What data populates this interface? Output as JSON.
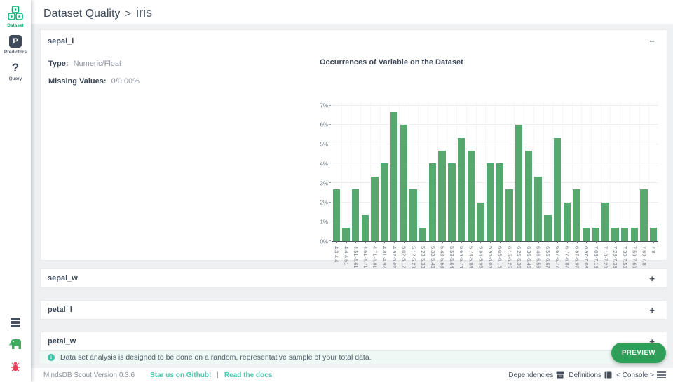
{
  "header": {
    "breadcrumb": "Dataset Quality",
    "separator": ">",
    "dataset": "iris"
  },
  "sidebar": {
    "items": [
      {
        "label": "Dataset"
      },
      {
        "label": "Predictors",
        "icon_text": "P"
      },
      {
        "label": "Query",
        "icon_text": "?"
      }
    ]
  },
  "panels": [
    {
      "title": "sepal_l",
      "toggle": "−",
      "fields": [
        {
          "label": "Type:",
          "value": "Numeric/Float"
        },
        {
          "label": "Missing Values:",
          "value": "0/0.00%"
        }
      ]
    },
    {
      "title": "sepal_w",
      "toggle": "+"
    },
    {
      "title": "petal_l",
      "toggle": "+"
    },
    {
      "title": "petal_w",
      "toggle": "+"
    }
  ],
  "info_bar": {
    "icon_glyph": "i",
    "text": "Data set analysis is designed to be done on a random, representative sample of your total data."
  },
  "preview_button": {
    "label": "PREVIEW"
  },
  "footer": {
    "version": "MindsDB Scout Version 0.3.6",
    "star_link": "Star us on Github!",
    "divider": "|",
    "docs_link": "Read the docs",
    "dependencies_label": "Dependencies",
    "definitions_label": "Definitions",
    "console_label": "< Console >"
  },
  "colors": {
    "accent_green": "#00b06d",
    "preview_green": "#2f9e58",
    "link_teal": "#53c4ae",
    "info_teal": "#3fc0a8",
    "bug_red": "#e4445a"
  },
  "chart_data": {
    "type": "bar",
    "title": "Occurrences of Variable on the Dataset",
    "xlabel": "",
    "ylabel": "",
    "categories": [
      "4.3-4.4",
      "4.4-4.51",
      "4.51-4.61",
      "4.61-4.71",
      "4.71-4.81",
      "4.81-4.92",
      "4.92-5.02",
      "5.02-5.12",
      "5.12-5.23",
      "5.23-5.33",
      "5.33-5.43",
      "5.43-5.53",
      "5.53-5.64",
      "5.64-5.74",
      "5.74-5.84",
      "5.84-5.95",
      "5.95-6.05",
      "6.05-6.15",
      "6.15-6.25",
      "6.25-6.36",
      "6.36-6.46",
      "6.46-6.56",
      "6.56-6.67",
      "6.67-6.77",
      "6.77-6.87",
      "6.87-6.97",
      "6.97-7.08",
      "7.08-7.18",
      "7.18-7.28",
      "7.28-7.39",
      "7.39-7.59",
      "7.59-7.69",
      "7.69-7.8",
      "7.8"
    ],
    "values": [
      2.67,
      0.67,
      2.67,
      1.33,
      3.33,
      4,
      6.67,
      6,
      2.67,
      0.67,
      4,
      4.67,
      4,
      5.33,
      4.67,
      2,
      4,
      4,
      2.67,
      6,
      4.67,
      3.33,
      1.33,
      5.33,
      2,
      2.67,
      0.67,
      0.67,
      2,
      0.67,
      0.67,
      0.67,
      2.67,
      0.67
    ],
    "yticks": [
      0,
      1,
      2,
      3,
      4,
      5,
      6,
      7
    ],
    "ytick_suffix": "%",
    "ylim": [
      0,
      7.2
    ],
    "grid": true,
    "legend": false,
    "bar_color": "#57a86f"
  }
}
